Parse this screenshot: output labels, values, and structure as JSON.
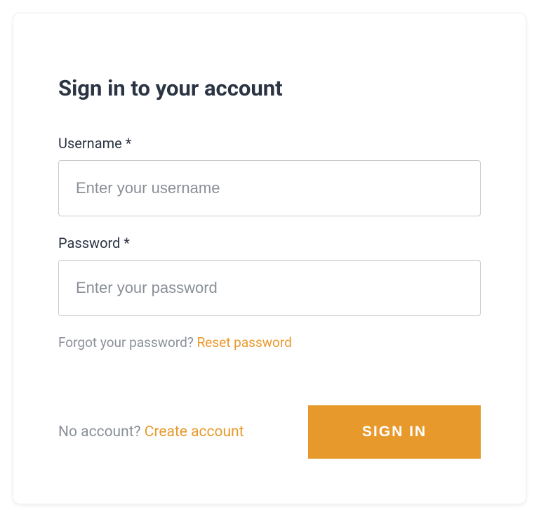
{
  "title": "Sign in to your account",
  "username": {
    "label": "Username *",
    "placeholder": "Enter your username",
    "value": ""
  },
  "password": {
    "label": "Password *",
    "placeholder": "Enter your password",
    "value": ""
  },
  "forgot": {
    "prompt": "Forgot your password? ",
    "link": "Reset password"
  },
  "create": {
    "prompt": "No account? ",
    "link": "Create account"
  },
  "signin_label": "SIGN IN",
  "colors": {
    "accent": "#e8992b",
    "text": "#2b3442",
    "muted": "#8a8f98",
    "border": "#c9c9c9"
  }
}
